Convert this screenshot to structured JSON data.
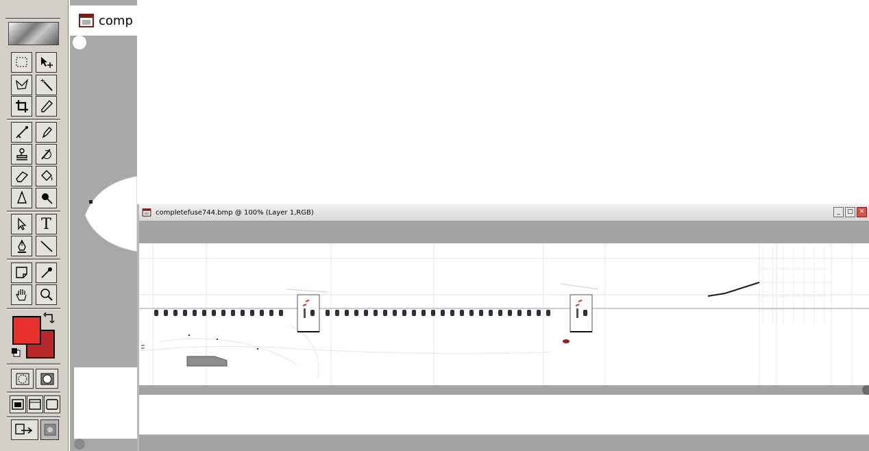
{
  "background_document": {
    "title": "comp"
  },
  "main_document": {
    "title": "completefuse744.bmp @ 100% (Layer 1,RGB)"
  },
  "toolbox": {
    "tools": [
      {
        "name": "marquee-tool",
        "glyph": "⬚"
      },
      {
        "name": "move-tool",
        "glyph": "↖"
      },
      {
        "name": "lasso-tool",
        "glyph": "lasso"
      },
      {
        "name": "magic-wand-tool",
        "glyph": "wand"
      },
      {
        "name": "crop-tool",
        "glyph": "crop"
      },
      {
        "name": "slice-tool",
        "glyph": "slice"
      },
      {
        "name": "airbrush-tool",
        "glyph": "airbrush"
      },
      {
        "name": "pencil-tool",
        "glyph": "pencil"
      },
      {
        "name": "stamp-tool",
        "glyph": "stamp"
      },
      {
        "name": "history-brush-tool",
        "glyph": "history"
      },
      {
        "name": "eraser-tool",
        "glyph": "eraser"
      },
      {
        "name": "paint-bucket-tool",
        "glyph": "bucket"
      },
      {
        "name": "blur-tool",
        "glyph": "blur"
      },
      {
        "name": "dodge-tool",
        "glyph": "dodge"
      },
      {
        "name": "path-selection-tool",
        "glyph": "arrow"
      },
      {
        "name": "type-tool",
        "glyph": "T"
      },
      {
        "name": "pen-tool",
        "glyph": "pen"
      },
      {
        "name": "line-tool",
        "glyph": "line"
      },
      {
        "name": "notes-tool",
        "glyph": "notes"
      },
      {
        "name": "eyedropper-tool",
        "glyph": "eyedropper"
      },
      {
        "name": "hand-tool",
        "glyph": "hand"
      },
      {
        "name": "zoom-tool",
        "glyph": "zoom"
      }
    ],
    "foreground_color": "#e8302c",
    "background_color": "#b8292a"
  }
}
